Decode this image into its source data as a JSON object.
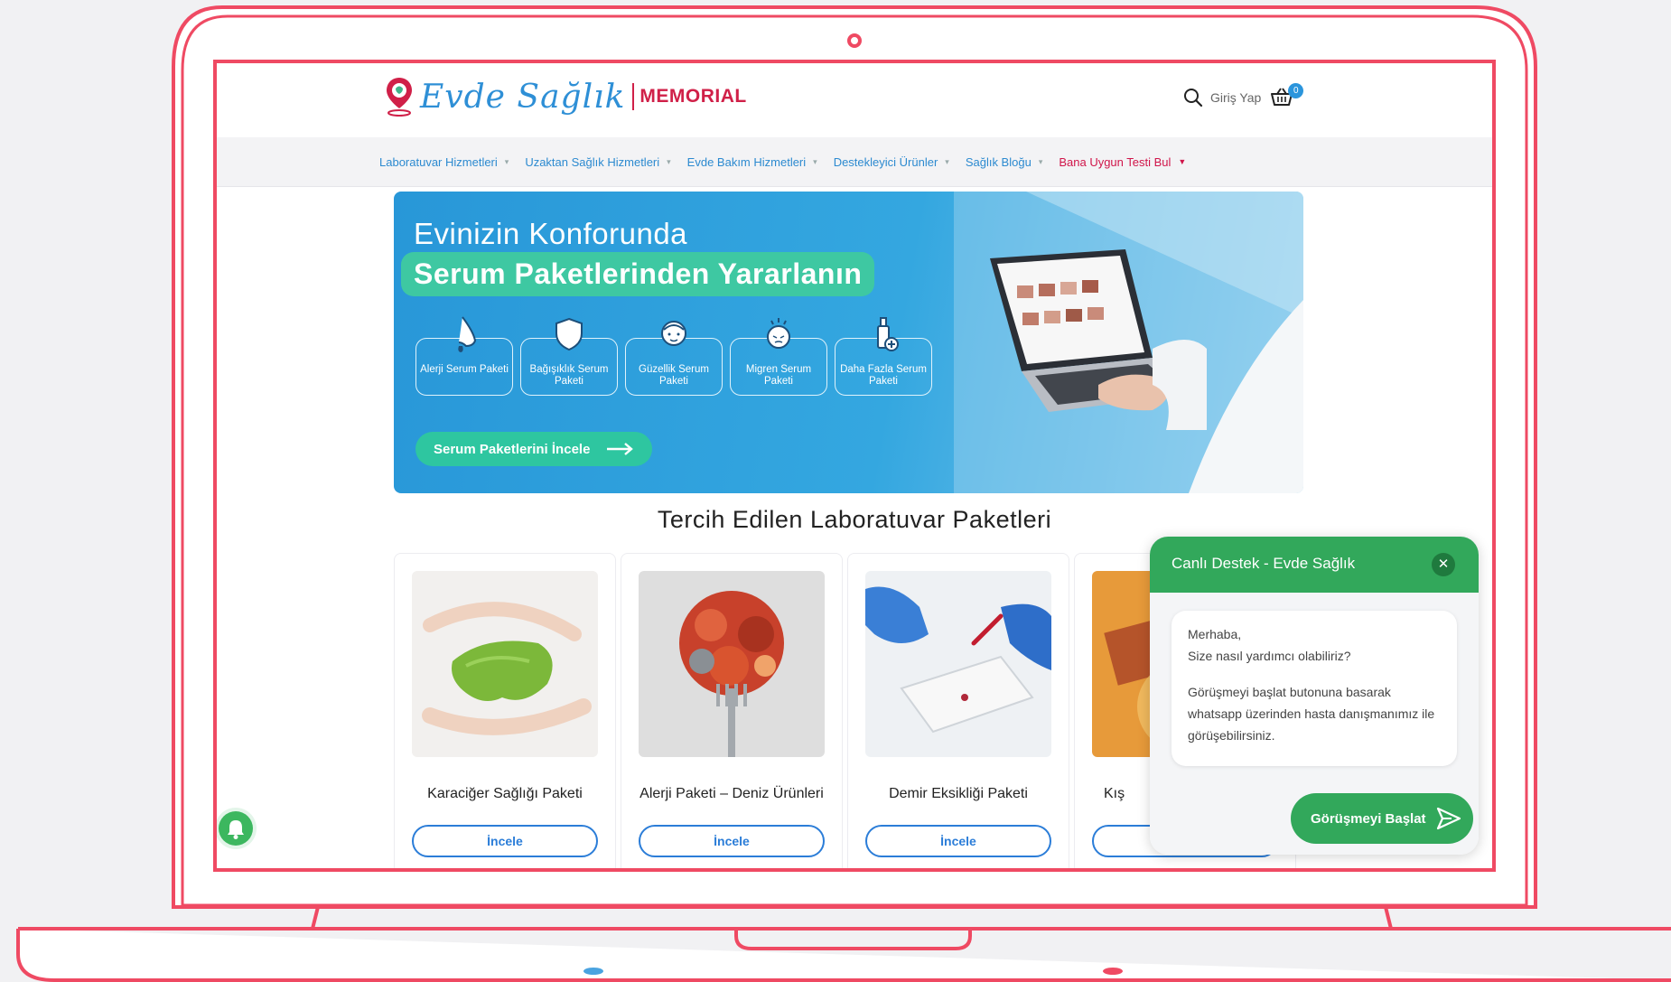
{
  "header": {
    "logo_script": "Evde Sağlık",
    "logo_brand": "MEMORIAL",
    "login_label": "Giriş Yap",
    "cart_count": "0"
  },
  "nav": {
    "items": [
      {
        "label": "Laboratuvar Hizmetleri"
      },
      {
        "label": "Uzaktan Sağlık Hizmetleri"
      },
      {
        "label": "Evde Bakım Hizmetleri"
      },
      {
        "label": "Destekleyici Ürünler"
      },
      {
        "label": "Sağlık Bloğu"
      },
      {
        "label": "Bana Uygun Testi Bul"
      }
    ]
  },
  "banner": {
    "line1": "Evinizin Konforunda",
    "line2": "Serum Paketlerinden Yararlanın",
    "services": [
      {
        "label": "Alerji Serum Paketi",
        "icon": "nose-icon"
      },
      {
        "label": "Bağışıklık Serum Paketi",
        "icon": "shield-icon"
      },
      {
        "label": "Güzellik Serum Paketi",
        "icon": "face-icon"
      },
      {
        "label": "Migren Serum Paketi",
        "icon": "headache-icon"
      },
      {
        "label": "Daha Fazla Serum Paketi",
        "icon": "serum-bottle-icon"
      }
    ],
    "cta_label": "Serum Paketlerini İncele"
  },
  "section": {
    "title": "Tercih Edilen Laboratuvar Paketleri"
  },
  "cards": [
    {
      "title": "Karaciğer Sağlığı Paketi",
      "button": "İncele"
    },
    {
      "title": "Alerji Paketi – Deniz Ürünleri",
      "button": "İncele"
    },
    {
      "title": "Demir Eksikliği Paketi",
      "button": "İncele"
    },
    {
      "title": "Kış",
      "button": "İncele"
    }
  ],
  "chat": {
    "title": "Canlı Destek - Evde Sağlık",
    "greeting": "Merhaba,",
    "question": "Size nasıl yardımcı olabiliriz?",
    "message": "Görüşmeyi başlat butonuna basarak whatsapp üzerinden hasta danışmanımız ile görüşebilirsiniz.",
    "button": "Görüşmeyi Başlat"
  },
  "colors": {
    "frame": "#ef4a63",
    "brand_blue": "#2c8ad0",
    "brand_red": "#d0154a",
    "banner_bg": "#2897d8",
    "accent_green": "#2ec6a0",
    "chat_green": "#32a85b"
  }
}
